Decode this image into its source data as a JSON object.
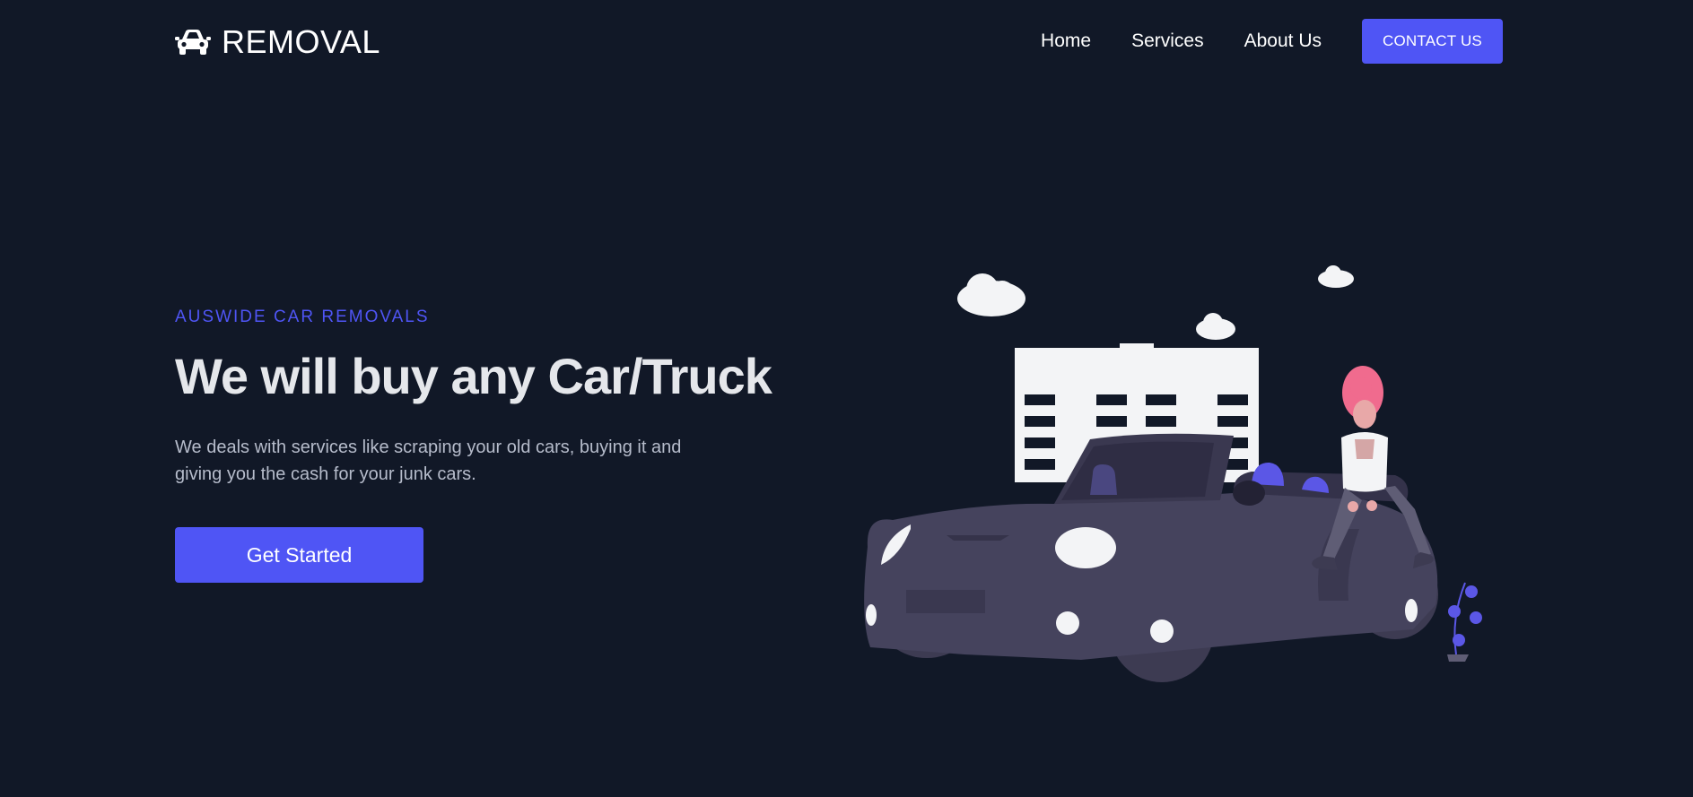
{
  "brand": {
    "name": "REMOVAL",
    "icon": "car-icon"
  },
  "nav": {
    "links": [
      "Home",
      "Services",
      "About Us"
    ],
    "contact_label": "CONTACT US"
  },
  "hero": {
    "eyebrow": "AUSWIDE CAR REMOVALS",
    "headline": "We will buy any Car/Truck",
    "description": "We deals with services like scraping your old cars, buying it and giving you the cash for your junk cars.",
    "cta_label": "Get Started"
  },
  "colors": {
    "background": "#111827",
    "accent": "#4f55f5",
    "headline": "#e5e7eb",
    "body_text": "#b6bccb"
  }
}
